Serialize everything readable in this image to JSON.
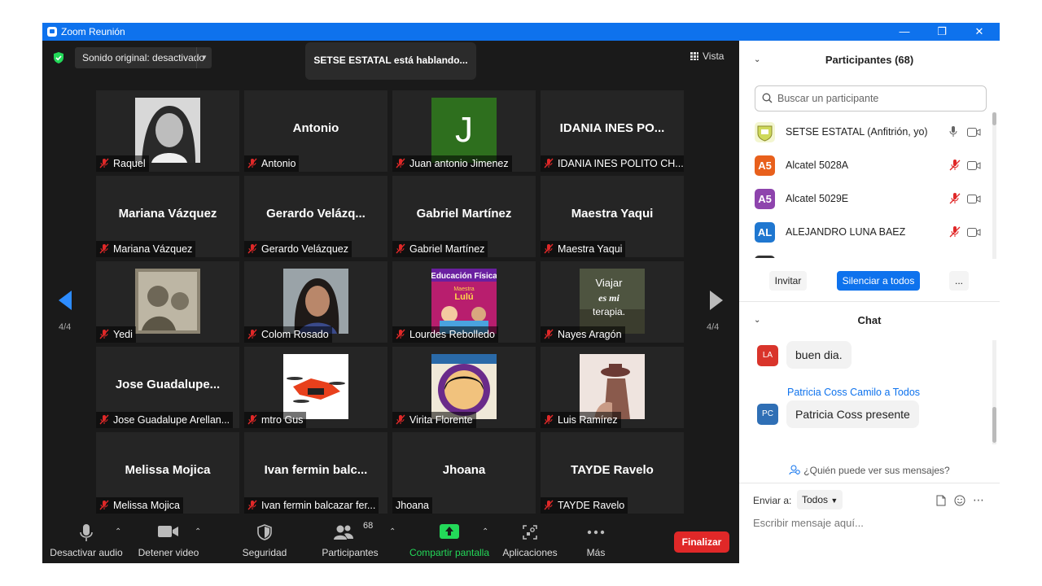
{
  "window": {
    "title": "Zoom Reunión"
  },
  "top": {
    "sound_label": "Sonido original: desactivado",
    "speaking": "SETSE ESTATAL está hablando...",
    "view_label": "Vista"
  },
  "pager": {
    "left": "4/4",
    "right": "4/4"
  },
  "tiles": [
    {
      "big": "",
      "name": "Raquel",
      "muted": true,
      "photo": "bw-portrait"
    },
    {
      "big": "Antonio",
      "name": "Antonio",
      "muted": true
    },
    {
      "big": "",
      "name": "Juan antonio Jimenez",
      "muted": true,
      "avatar_letter": "J",
      "avatar_color": "#2e6f1e"
    },
    {
      "big": "IDANIA INES PO...",
      "name": "IDANIA INES POLITO CH...",
      "muted": true
    },
    {
      "big": "Mariana Vázquez",
      "name": "Mariana Vázquez",
      "muted": true
    },
    {
      "big": "Gerardo  Velázq...",
      "name": "Gerardo Velázquez",
      "muted": true
    },
    {
      "big": "Gabriel Martínez",
      "name": "Gabriel Martínez",
      "muted": true
    },
    {
      "big": "Maestra Yaqui",
      "name": "Maestra Yaqui",
      "muted": true
    },
    {
      "big": "",
      "name": "Yedi",
      "muted": true,
      "photo": "sepia-family"
    },
    {
      "big": "",
      "name": "Colom Rosado",
      "muted": true,
      "photo": "woman-portrait"
    },
    {
      "big": "",
      "name": "Lourdes Rebolledo",
      "muted": true,
      "photo": "educacion-fisica"
    },
    {
      "big": "",
      "name": "Nayes Aragón",
      "muted": true,
      "photo": "viajar"
    },
    {
      "big": "Jose  Guadalupe...",
      "name": "Jose Guadalupe Arellan...",
      "muted": true
    },
    {
      "big": "",
      "name": "mtro Gus",
      "muted": true,
      "photo": "drone"
    },
    {
      "big": "",
      "name": "Virita Florente",
      "muted": true,
      "photo": "educador-fisico"
    },
    {
      "big": "",
      "name": "Luis Ramírez",
      "muted": true,
      "photo": "hat-figure"
    },
    {
      "big": "Melissa Mojica",
      "name": "Melissa Mojica",
      "muted": true
    },
    {
      "big": "Ivan  fermin  balc...",
      "name": "Ivan fermin balcazar fer...",
      "muted": true
    },
    {
      "big": "Jhoana",
      "name": "Jhoana",
      "muted": false
    },
    {
      "big": "TAYDE Ravelo",
      "name": "TAYDE Ravelo",
      "muted": true
    }
  ],
  "photo_text": {
    "educacion_fisica_title": "Educación Física",
    "maestra": "Maestra",
    "lulu": "Lulú",
    "viajar_1": "Viajar",
    "viajar_2": "es mi",
    "viajar_3": "terapia."
  },
  "toolbar": {
    "mute": "Desactivar audio",
    "video": "Detener video",
    "security": "Seguridad",
    "participants": "Participantes",
    "participants_count": "68",
    "share": "Compartir pantalla",
    "apps": "Aplicaciones",
    "more": "Más",
    "end": "Finalizar"
  },
  "participants_panel": {
    "header": "Participantes (68)",
    "search_placeholder": "Buscar un participante",
    "list": [
      {
        "initials": "",
        "name": "SETSE ESTATAL (Anfitrión, yo)",
        "color": "#cfd95b",
        "muted": false
      },
      {
        "initials": "A5",
        "name": "Alcatel 5028A",
        "color": "#e8601c",
        "muted": true
      },
      {
        "initials": "A5",
        "name": "Alcatel 5029E",
        "color": "#8e44ad",
        "muted": true
      },
      {
        "initials": "AL",
        "name": "ALEJANDRO LUNA BAEZ",
        "color": "#1f77d0",
        "muted": true
      }
    ],
    "invite": "Invitar",
    "mute_all": "Silenciar a todos",
    "more": "..."
  },
  "chat": {
    "header": "Chat",
    "messages": [
      {
        "initials": "LA",
        "color": "#d9342b",
        "text": "buen dia."
      },
      {
        "initials": "PC",
        "color": "#2f6fb5",
        "sender": "Patricia Coss Camilo a Todos",
        "text": "Patricia Coss presente"
      }
    ],
    "who_can_see": "¿Quién puede ver sus mensajes?",
    "send_to_label": "Enviar a:",
    "send_to_value": "Todos",
    "input_placeholder": "Escribir mensaje aquí..."
  },
  "colors": {
    "titlebar": "#0e72ed",
    "accent": "#0e72ed",
    "end": "#e02828",
    "share": "#23d959",
    "muted_red": "#e02828"
  }
}
